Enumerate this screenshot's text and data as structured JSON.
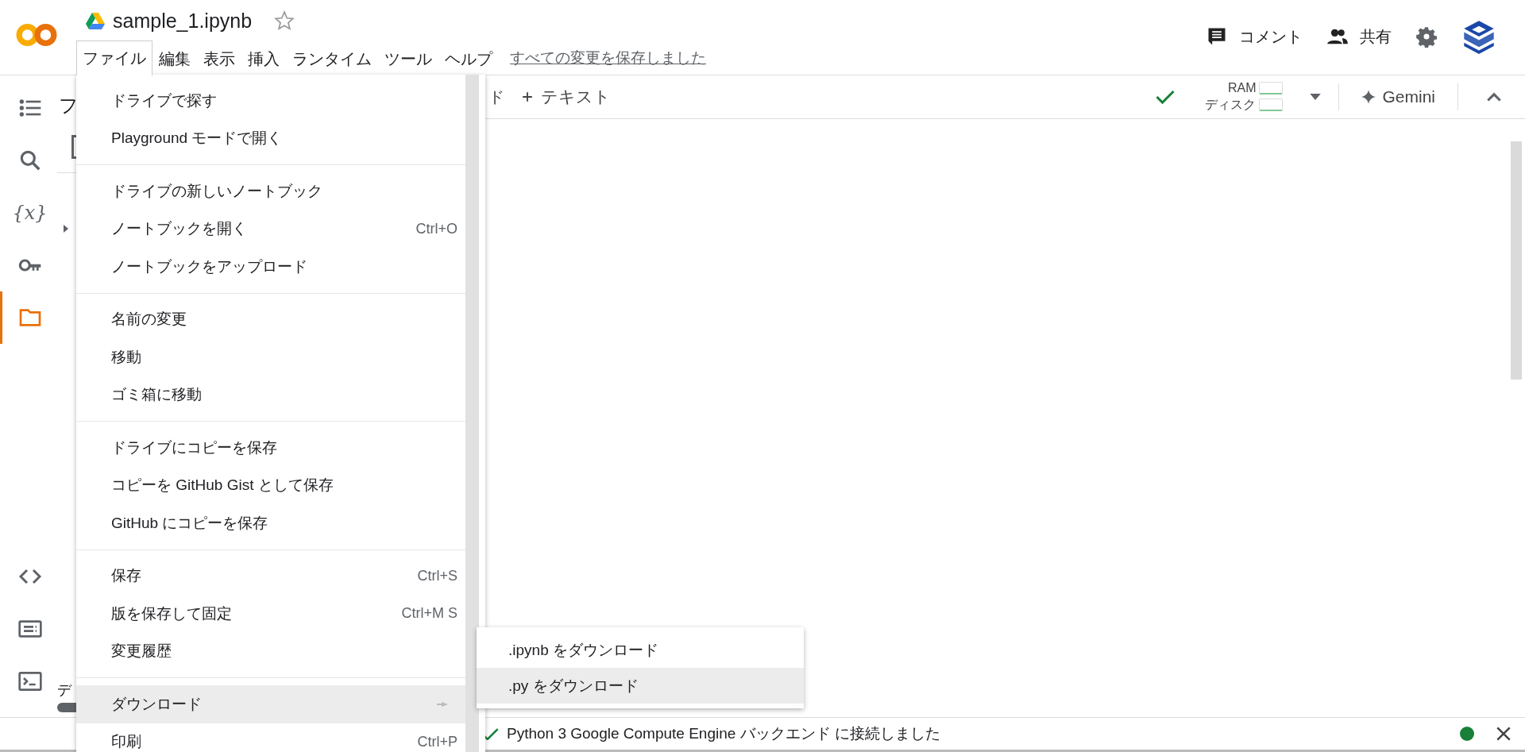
{
  "header": {
    "title": "sample_1.ipynb",
    "starred": false,
    "menus": [
      {
        "label": "ファイル",
        "selected": true
      },
      {
        "label": "編集",
        "selected": false
      },
      {
        "label": "表示",
        "selected": false
      },
      {
        "label": "挿入",
        "selected": false
      },
      {
        "label": "ランタイム",
        "selected": false
      },
      {
        "label": "ツール",
        "selected": false
      },
      {
        "label": "ヘルプ",
        "selected": false
      }
    ],
    "save_status": "すべての変更を保存しました",
    "actions": [
      {
        "kind": "comment",
        "label": "コメント"
      },
      {
        "kind": "share",
        "label": "共有"
      }
    ]
  },
  "sidebar": {
    "items": [
      {
        "kind": "toc",
        "selected": false
      },
      {
        "kind": "search",
        "selected": false
      },
      {
        "kind": "variables",
        "label": "{x}",
        "selected": false
      },
      {
        "kind": "key",
        "selected": false
      },
      {
        "kind": "folder",
        "selected": true
      }
    ],
    "bottom_items": [
      {
        "kind": "code"
      },
      {
        "kind": "palette"
      },
      {
        "kind": "terminal"
      }
    ]
  },
  "side_panel": {
    "heading": "フ",
    "footer": "デ"
  },
  "toolbar": {
    "partial_button": "ド",
    "add_text": "テキスト",
    "connected": true,
    "resources": [
      {
        "label": "RAM"
      },
      {
        "label": "ディスク"
      }
    ],
    "gemini": "Gemini"
  },
  "file_menu": {
    "groups": [
      [
        {
          "label": "ドライブで探す",
          "selected": false
        },
        {
          "label": "Playground モードで開く",
          "selected": false
        }
      ],
      [
        {
          "label": "ドライブの新しいノートブック",
          "selected": false
        },
        {
          "label": "ノートブックを開く",
          "shortcut": "Ctrl+O",
          "selected": false
        },
        {
          "label": "ノートブックをアップロード",
          "selected": false
        }
      ],
      [
        {
          "label": "名前の変更",
          "selected": false
        },
        {
          "label": "移動",
          "selected": false
        },
        {
          "label": "ゴミ箱に移動",
          "selected": false
        }
      ],
      [
        {
          "label": "ドライブにコピーを保存",
          "selected": false
        },
        {
          "label": "コピーを GitHub Gist として保存",
          "selected": false
        },
        {
          "label": "GitHub にコピーを保存",
          "selected": false
        }
      ],
      [
        {
          "label": "保存",
          "shortcut": "Ctrl+S",
          "selected": false
        },
        {
          "label": "版を保存して固定",
          "shortcut": "Ctrl+M S",
          "selected": false
        },
        {
          "label": "変更履歴",
          "selected": false
        }
      ],
      [
        {
          "label": "ダウンロード",
          "submenu": true,
          "selected": true
        },
        {
          "label": "印刷",
          "shortcut": "Ctrl+P",
          "selected": false
        }
      ]
    ]
  },
  "download_submenu": {
    "items": [
      {
        "label": ".ipynb をダウンロード",
        "selected": false
      },
      {
        "label": ".py をダウンロード",
        "selected": true
      }
    ]
  },
  "status_bar": {
    "connected": true,
    "message": "Python 3 Google Compute Engine バックエンド に接続しました"
  }
}
